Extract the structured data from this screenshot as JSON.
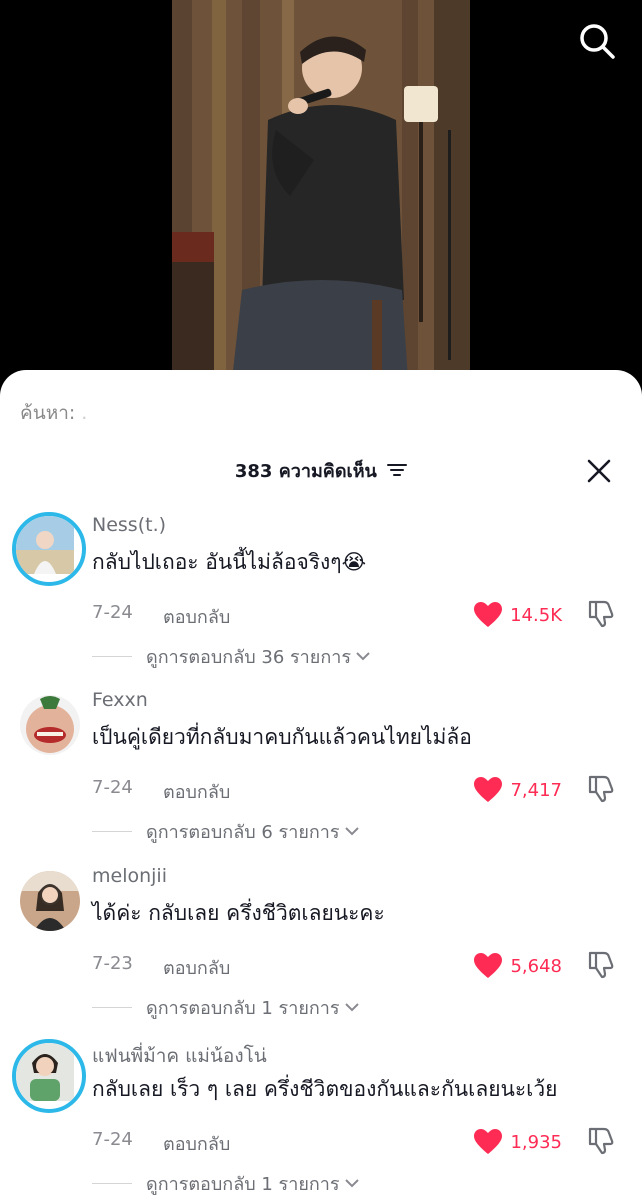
{
  "search": {
    "hint": "ค้นหา:",
    "hint_value": "."
  },
  "header": {
    "count": "383",
    "label": "ความคิดเห็น"
  },
  "colors": {
    "like": "#fe2c55",
    "story_ring": "#2cb8e8"
  },
  "comments": [
    {
      "username": "Ness(t.)",
      "text": "กลับไปเถอะ อันนี้ไม่ล้อจริงๆ😭",
      "date": "7-24",
      "reply_label": "ตอบกลับ",
      "likes": "14.5K",
      "view_replies": "ดูการตอบกลับ 36 รายการ",
      "has_story_ring": true
    },
    {
      "username": "Fexxn",
      "text": "เป็นคู่เดียวที่กลับมาคบกันแล้วคนไทยไม่ล้อ",
      "date": "7-24",
      "reply_label": "ตอบกลับ",
      "likes": "7,417",
      "view_replies": "ดูการตอบกลับ 6 รายการ",
      "has_story_ring": false
    },
    {
      "username": "melonjii",
      "text": "ได้ค่ะ กลับเลย ครึ่งชีวิตเลยนะคะ",
      "date": "7-23",
      "reply_label": "ตอบกลับ",
      "likes": "5,648",
      "view_replies": "ดูการตอบกลับ 1 รายการ",
      "has_story_ring": false
    },
    {
      "username": "แฟนพี่ม้าค แม่น้องโน่",
      "text": "กลับเลย เร็ว ๆ เลย ครึ่งชีวิตของกันและกันเลยนะเว้ย",
      "date": "7-24",
      "reply_label": "ตอบกลับ",
      "likes": "1,935",
      "view_replies": "ดูการตอบกลับ 1 รายการ",
      "has_story_ring": true
    }
  ]
}
